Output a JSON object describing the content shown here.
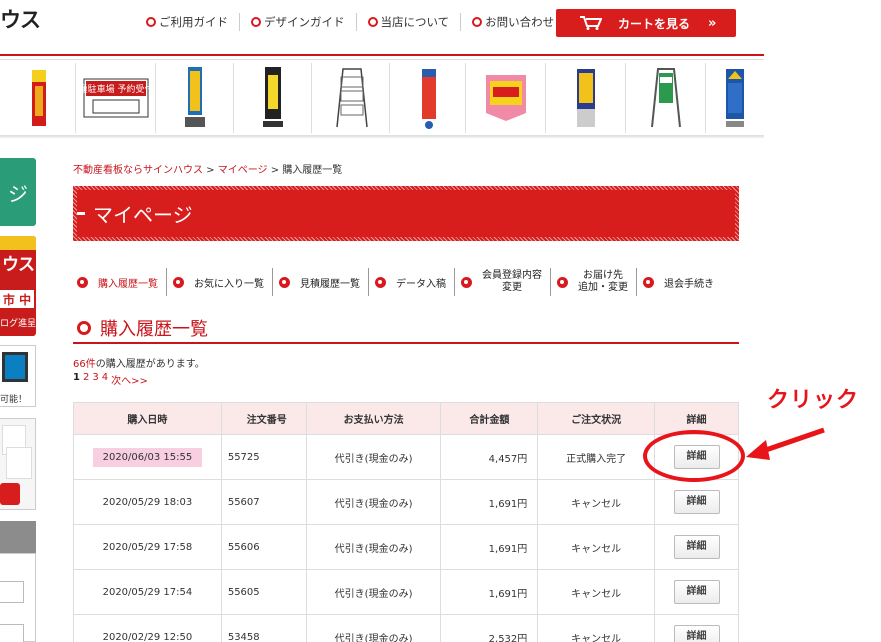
{
  "header": {
    "logo_text": "ウス",
    "nav": [
      {
        "label": "ご利用ガイド"
      },
      {
        "label": "デザインガイド"
      },
      {
        "label": "当店について"
      },
      {
        "label": "お問い合わせ"
      }
    ],
    "cart_label": "カートを見る",
    "cart_suffix": "»"
  },
  "sidebar": {
    "green_label": "ジ",
    "banner_line1": "ウス",
    "banner_line2": "市 中",
    "banner_line3": "ログ進呈",
    "monitor_label": "可能！"
  },
  "strip_items": [
    {
      "label": "月極駐車場 予約受付中"
    }
  ],
  "breadcrumb": {
    "home": "不動産看板ならサインハウス",
    "sep": " > ",
    "mypage": "マイページ",
    "sep2": " > ",
    "current": "購入履歴一覧"
  },
  "title": "マイページ",
  "subnav": [
    {
      "label": "購入履歴一覧",
      "active": true
    },
    {
      "label": "お気に入り一覧"
    },
    {
      "label": "見積履歴一覧"
    },
    {
      "label": "データ入稿"
    },
    {
      "label_1": "会員登録内容",
      "label_2": "変更"
    },
    {
      "label_1": "お届け先",
      "label_2": "追加・変更"
    },
    {
      "label": "退会手続き"
    }
  ],
  "section_title": "購入履歴一覧",
  "count": {
    "number": "66件",
    "suffix": "の購入履歴があります。"
  },
  "pager": {
    "current": "1",
    "pages": [
      "2",
      "3",
      "4"
    ],
    "next": "次へ>>"
  },
  "table": {
    "headers": [
      "購入日時",
      "注文番号",
      "お支払い方法",
      "合計金額",
      "ご注文状況",
      "詳細"
    ],
    "rows": [
      {
        "date": "2020/06/03 15:55",
        "order": "55725",
        "payment": "代引き(現金のみ)",
        "total": "4,457円",
        "status": "正式購入完了",
        "detail": "詳細"
      },
      {
        "date": "2020/05/29 18:03",
        "order": "55607",
        "payment": "代引き(現金のみ)",
        "total": "1,691円",
        "status": "キャンセル",
        "detail": "詳細"
      },
      {
        "date": "2020/05/29 17:58",
        "order": "55606",
        "payment": "代引き(現金のみ)",
        "total": "1,691円",
        "status": "キャンセル",
        "detail": "詳細"
      },
      {
        "date": "2020/05/29 17:54",
        "order": "55605",
        "payment": "代引き(現金のみ)",
        "total": "1,691円",
        "status": "キャンセル",
        "detail": "詳細"
      },
      {
        "date": "2020/02/29 12:50",
        "order": "53458",
        "payment": "代引き(現金のみ)",
        "total": "2,532円",
        "status": "キャンセル",
        "detail": "詳細"
      }
    ]
  },
  "annotation": {
    "text": "クリック"
  },
  "colors": {
    "brand_red": "#d81d1d",
    "highlight_pink": "#f7cfe0",
    "header_pink": "#fbe9ea",
    "annotation_red": "#e8141a"
  }
}
